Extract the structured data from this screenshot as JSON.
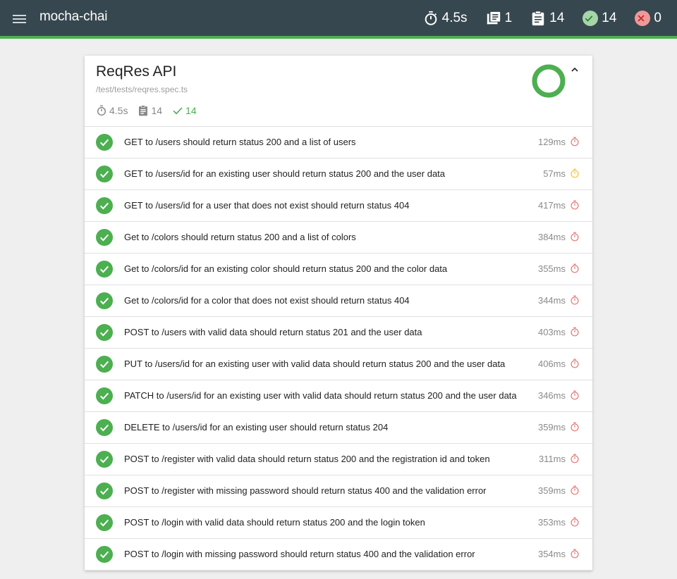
{
  "app": {
    "title": "mocha-chai"
  },
  "stats": {
    "duration": "4.5s",
    "suites": "1",
    "tests": "14",
    "passes": "14",
    "failures": "0"
  },
  "suite": {
    "title": "ReqRes API",
    "file": "/test/tests/reqres.spec.ts",
    "duration": "4.5s",
    "tests": "14",
    "passes": "14",
    "pass_rate": 1.0
  },
  "colors": {
    "pass": "#4caf50",
    "navbar": "#37474f",
    "slow": "#e57373",
    "medium": "#fbc02d"
  },
  "tests": [
    {
      "title": "GET to /users should return status 200 and a list of users",
      "duration": "129ms",
      "speed": "slow"
    },
    {
      "title": "GET to /users/id for an existing user should return status 200 and the user data",
      "duration": "57ms",
      "speed": "medium"
    },
    {
      "title": "GET to /users/id for a user that does not exist should return status 404",
      "duration": "417ms",
      "speed": "slow"
    },
    {
      "title": "Get to /colors should return status 200 and a list of colors",
      "duration": "384ms",
      "speed": "slow"
    },
    {
      "title": "Get to /colors/id for an existing color should return status 200 and the color data",
      "duration": "355ms",
      "speed": "slow"
    },
    {
      "title": "Get to /colors/id for a color that does not exist should return status 404",
      "duration": "344ms",
      "speed": "slow"
    },
    {
      "title": "POST to /users with valid data should return status 201 and the user data",
      "duration": "403ms",
      "speed": "slow"
    },
    {
      "title": "PUT to /users/id for an existing user with valid data should return status 200 and the user data",
      "duration": "406ms",
      "speed": "slow"
    },
    {
      "title": "PATCH to /users/id for an existing user with valid data should return status 200 and the user data",
      "duration": "346ms",
      "speed": "slow"
    },
    {
      "title": "DELETE to /users/id for an existing user should return status 204",
      "duration": "359ms",
      "speed": "slow"
    },
    {
      "title": "POST to /register with valid data should return status 200 and the registration id and token",
      "duration": "311ms",
      "speed": "slow"
    },
    {
      "title": "POST to /register with missing password should return status 400 and the validation error",
      "duration": "359ms",
      "speed": "slow"
    },
    {
      "title": "POST to /login with valid data should return status 200 and the login token",
      "duration": "353ms",
      "speed": "slow"
    },
    {
      "title": "POST to /login with missing password should return status 400 and the validation error",
      "duration": "354ms",
      "speed": "slow"
    }
  ]
}
